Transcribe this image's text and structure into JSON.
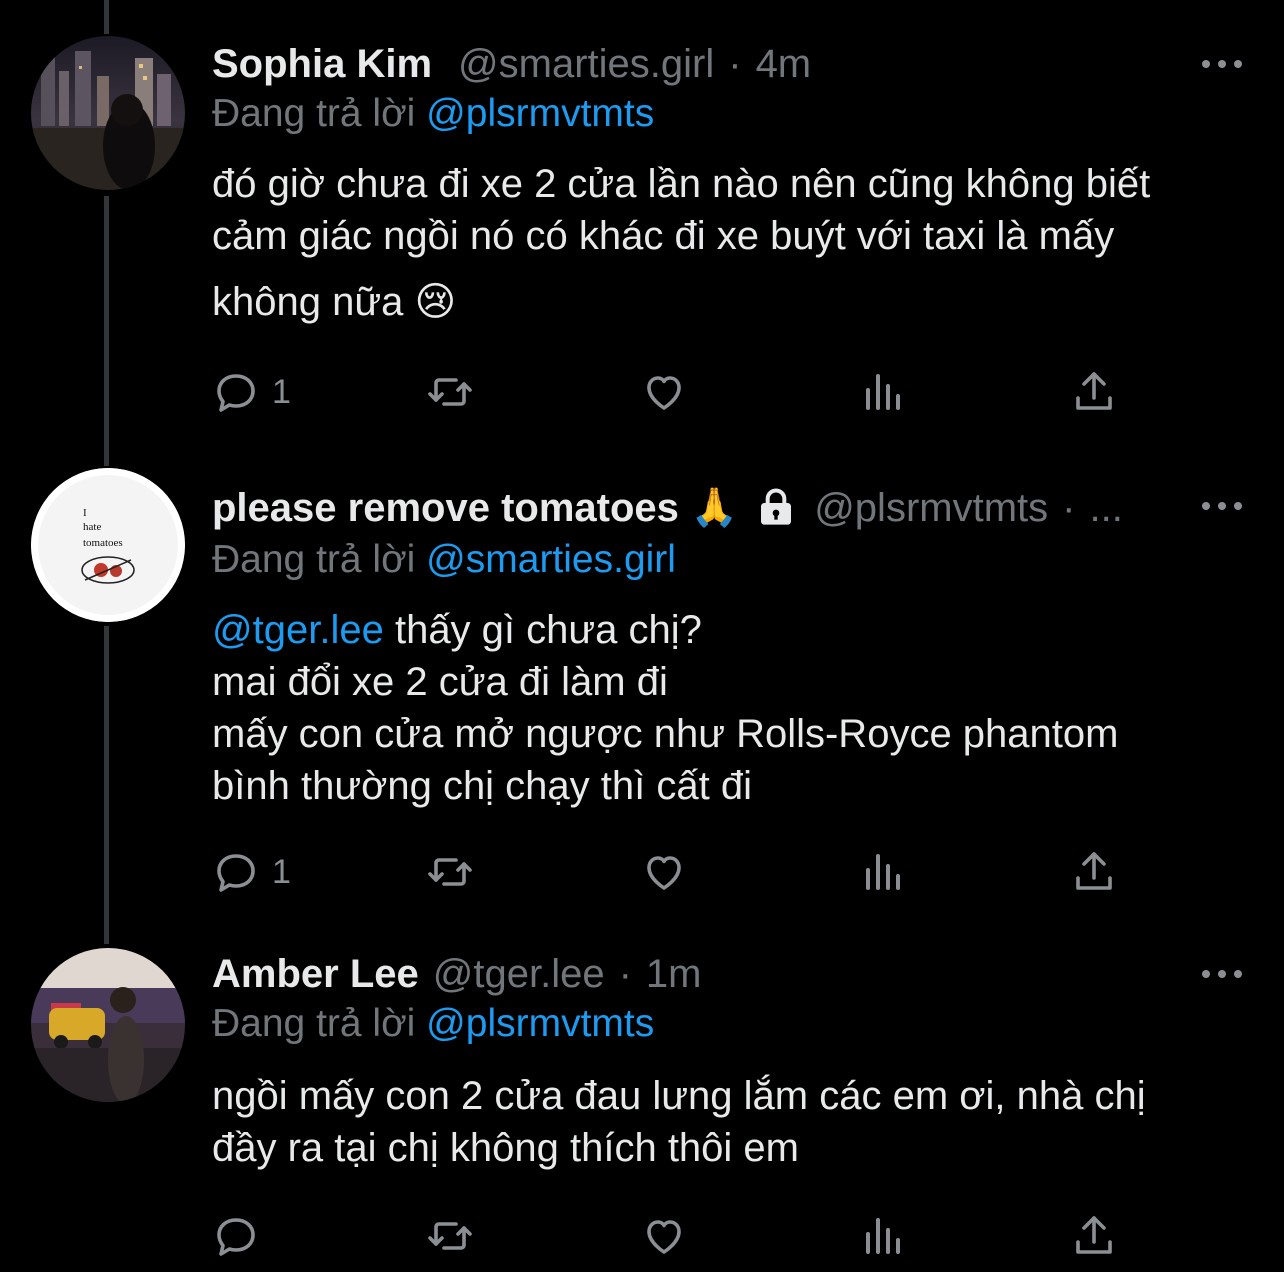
{
  "tweets": [
    {
      "name": "Sophia Kim",
      "handle": "@smarties.girl",
      "separator": "·",
      "time": "4m",
      "reply_prefix": "Đang trả lời",
      "reply_to": "@plsrmvtmts",
      "lines": [
        "đó giờ chưa đi xe 2 cửa lần nào nên cũng không biết",
        "cảm giác ngồi nó có khác đi xe buýt với taxi là mấy",
        "không nữa 😢"
      ],
      "reply_count": "1",
      "retweet_count": "",
      "like_count": ""
    },
    {
      "name": "please remove tomatoes",
      "name_emoji": "🙏",
      "handle": "@plsrmvtmts",
      "separator": "·",
      "time": "...",
      "reply_prefix": "Đang trả lời",
      "reply_to": "@smarties.girl",
      "mention": "@tger.lee",
      "lines": [
        "thấy gì chưa chị?",
        "mai đổi xe 2 cửa đi làm đi",
        "mấy con cửa mở ngược như Rolls-Royce phantom",
        "bình thường chị chạy thì cất đi"
      ],
      "avatar_text": [
        "I",
        "hate",
        "tomatoes"
      ],
      "reply_count": "1",
      "retweet_count": "",
      "like_count": ""
    },
    {
      "name": "Amber Lee",
      "handle": "@tger.lee",
      "separator": "·",
      "time": "1m",
      "reply_prefix": "Đang trả lời",
      "reply_to": "@plsrmvtmts",
      "lines": [
        "ngồi mấy con 2 cửa đau lưng lắm các em ơi, nhà chị",
        "đầy ra tại chị không thích thôi em"
      ],
      "reply_count": "",
      "retweet_count": "",
      "like_count": ""
    }
  ],
  "colors": {
    "background": "#000000",
    "text": "#e7e9ea",
    "secondary": "#71767b",
    "accent": "#1d9bf0",
    "thread_line": "#333639"
  },
  "icons": [
    "reply-icon",
    "retweet-icon",
    "like-icon",
    "analytics-icon",
    "share-icon",
    "more-icon",
    "lock-icon"
  ]
}
